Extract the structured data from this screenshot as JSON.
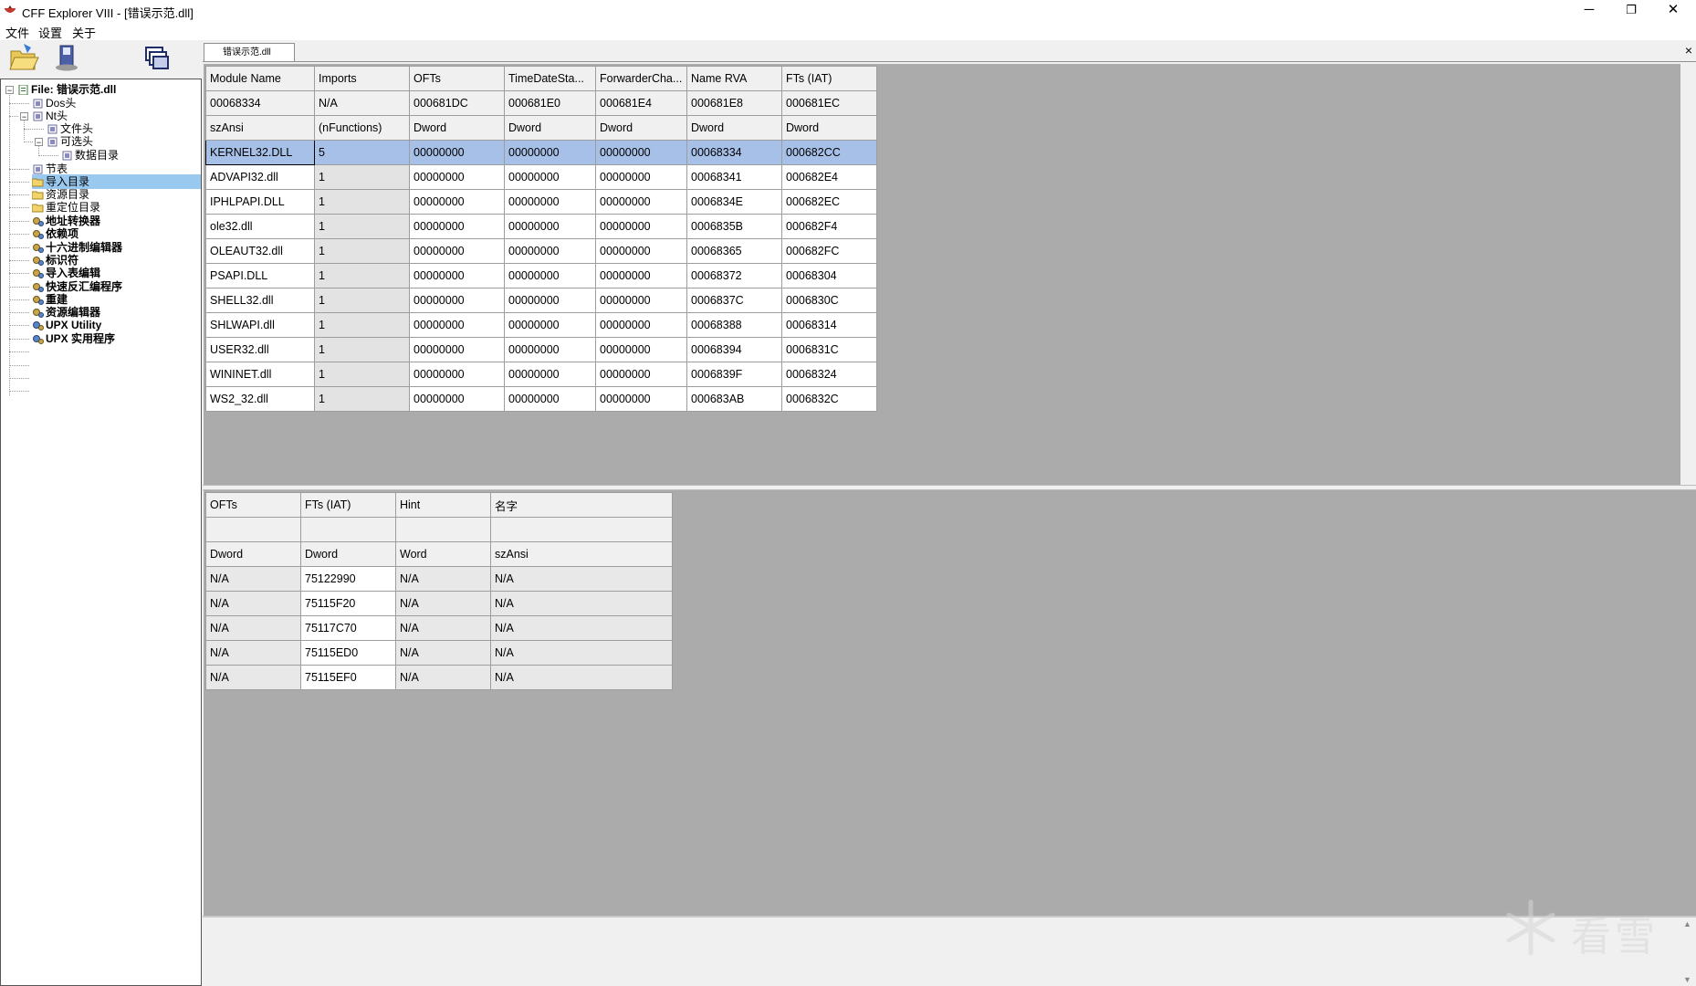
{
  "window": {
    "title": "CFF Explorer VIII - [错误示范.dll]",
    "minimize": "─",
    "restore": "❐",
    "close": "✕"
  },
  "menu": [
    "文件",
    "设置",
    "关于"
  ],
  "toolbar": {
    "open_icon": "folder-open-icon",
    "save_icon": "save-icon",
    "windows_icon": "windows-icon"
  },
  "tab": {
    "label": "错误示范.dll",
    "close": "×"
  },
  "tree": {
    "root": "File: 错误示范.dll",
    "dos_header": "Dos头",
    "nt_header": "Nt头",
    "file_header": "文件头",
    "optional_header": "可选头",
    "data_directories": "数据目录",
    "section_table": "节表",
    "import_directory": "导入目录",
    "resource_directory": "资源目录",
    "relocation_directory": "重定位目录",
    "address_converter": "地址转换器",
    "dependency_walker": "依赖项",
    "hex_editor": "十六进制编辑器",
    "identifier": "标识符",
    "import_adder": "导入表编辑",
    "quick_disassembler": "快速反汇编程序",
    "rebuilder": "重建",
    "resource_editor": "资源编辑器",
    "upx_utility": "UPX Utility",
    "upx_utility_cn": "UPX 实用程序"
  },
  "imports_table": {
    "headers": [
      "Module Name",
      "Imports",
      "OFTs",
      "TimeDateSta...",
      "ForwarderCha...",
      "Name RVA",
      "FTs (IAT)"
    ],
    "offsets": [
      "00068334",
      "N/A",
      "000681DC",
      "000681E0",
      "000681E4",
      "000681E8",
      "000681EC"
    ],
    "types": [
      "szAnsi",
      "(nFunctions)",
      "Dword",
      "Dword",
      "Dword",
      "Dword",
      "Dword"
    ],
    "rows": [
      [
        "KERNEL32.DLL",
        "5",
        "00000000",
        "00000000",
        "00000000",
        "00068334",
        "000682CC"
      ],
      [
        "ADVAPI32.dll",
        "1",
        "00000000",
        "00000000",
        "00000000",
        "00068341",
        "000682E4"
      ],
      [
        "IPHLPAPI.DLL",
        "1",
        "00000000",
        "00000000",
        "00000000",
        "0006834E",
        "000682EC"
      ],
      [
        "ole32.dll",
        "1",
        "00000000",
        "00000000",
        "00000000",
        "0006835B",
        "000682F4"
      ],
      [
        "OLEAUT32.dll",
        "1",
        "00000000",
        "00000000",
        "00000000",
        "00068365",
        "000682FC"
      ],
      [
        "PSAPI.DLL",
        "1",
        "00000000",
        "00000000",
        "00000000",
        "00068372",
        "00068304"
      ],
      [
        "SHELL32.dll",
        "1",
        "00000000",
        "00000000",
        "00000000",
        "0006837C",
        "0006830C"
      ],
      [
        "SHLWAPI.dll",
        "1",
        "00000000",
        "00000000",
        "00000000",
        "00068388",
        "00068314"
      ],
      [
        "USER32.dll",
        "1",
        "00000000",
        "00000000",
        "00000000",
        "00068394",
        "0006831C"
      ],
      [
        "WININET.dll",
        "1",
        "00000000",
        "00000000",
        "00000000",
        "0006839F",
        "00068324"
      ],
      [
        "WS2_32.dll",
        "1",
        "00000000",
        "00000000",
        "00000000",
        "000683AB",
        "0006832C"
      ]
    ]
  },
  "functions_table": {
    "headers": [
      "OFTs",
      "FTs (IAT)",
      "Hint",
      "名字"
    ],
    "offsets": [
      "",
      "",
      "",
      ""
    ],
    "types": [
      "Dword",
      "Dword",
      "Word",
      "szAnsi"
    ],
    "rows": [
      [
        "N/A",
        "75122990",
        "N/A",
        "N/A"
      ],
      [
        "N/A",
        "75115F20",
        "N/A",
        "N/A"
      ],
      [
        "N/A",
        "75117C70",
        "N/A",
        "N/A"
      ],
      [
        "N/A",
        "75115ED0",
        "N/A",
        "N/A"
      ],
      [
        "N/A",
        "75115EF0",
        "N/A",
        "N/A"
      ]
    ]
  },
  "watermark": "看雪",
  "colors": {
    "selection": "#99c9ef",
    "grid_selection": "#a7c0e8",
    "panel_bg": "#ababab"
  }
}
